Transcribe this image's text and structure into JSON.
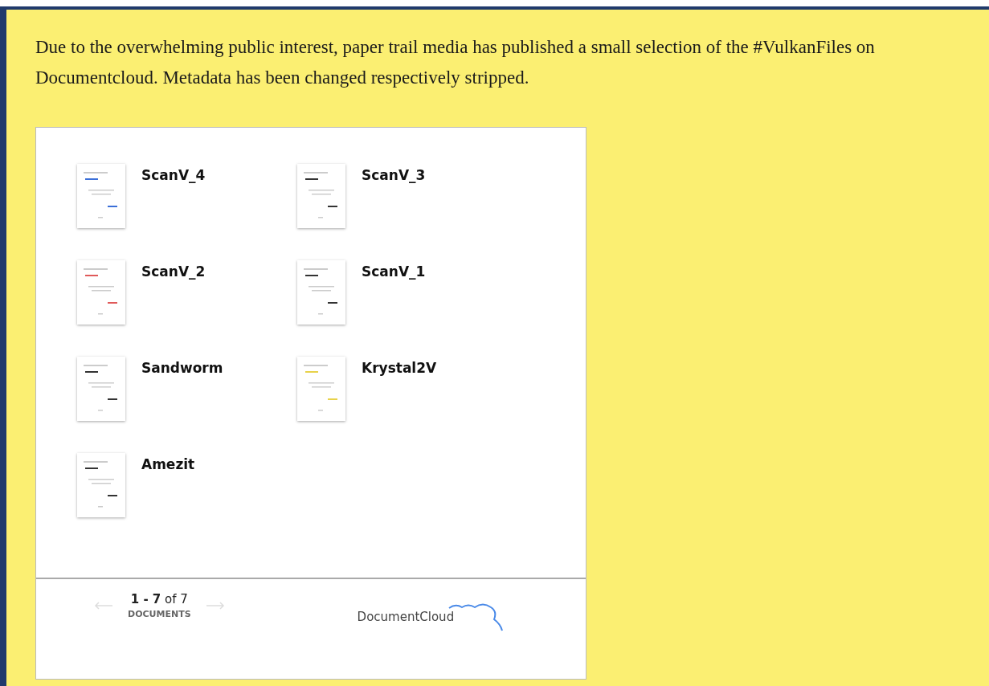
{
  "intro": "Due to the overwhelming public interest, paper trail media has published a small selection of the #VulkanFiles on Documentcloud. Metadata has been changed respectively stripped.",
  "documents": [
    {
      "title": "ScanV_4"
    },
    {
      "title": "ScanV_3"
    },
    {
      "title": "ScanV_2"
    },
    {
      "title": "ScanV_1"
    },
    {
      "title": "Sandworm"
    },
    {
      "title": "Krystal2V"
    },
    {
      "title": "Amezit"
    }
  ],
  "pager": {
    "prev_disabled": true,
    "next_disabled": true,
    "range": "**1 - 7** of 7",
    "unit": "DOCUMENTS"
  },
  "brand": "DocumentCloud"
}
